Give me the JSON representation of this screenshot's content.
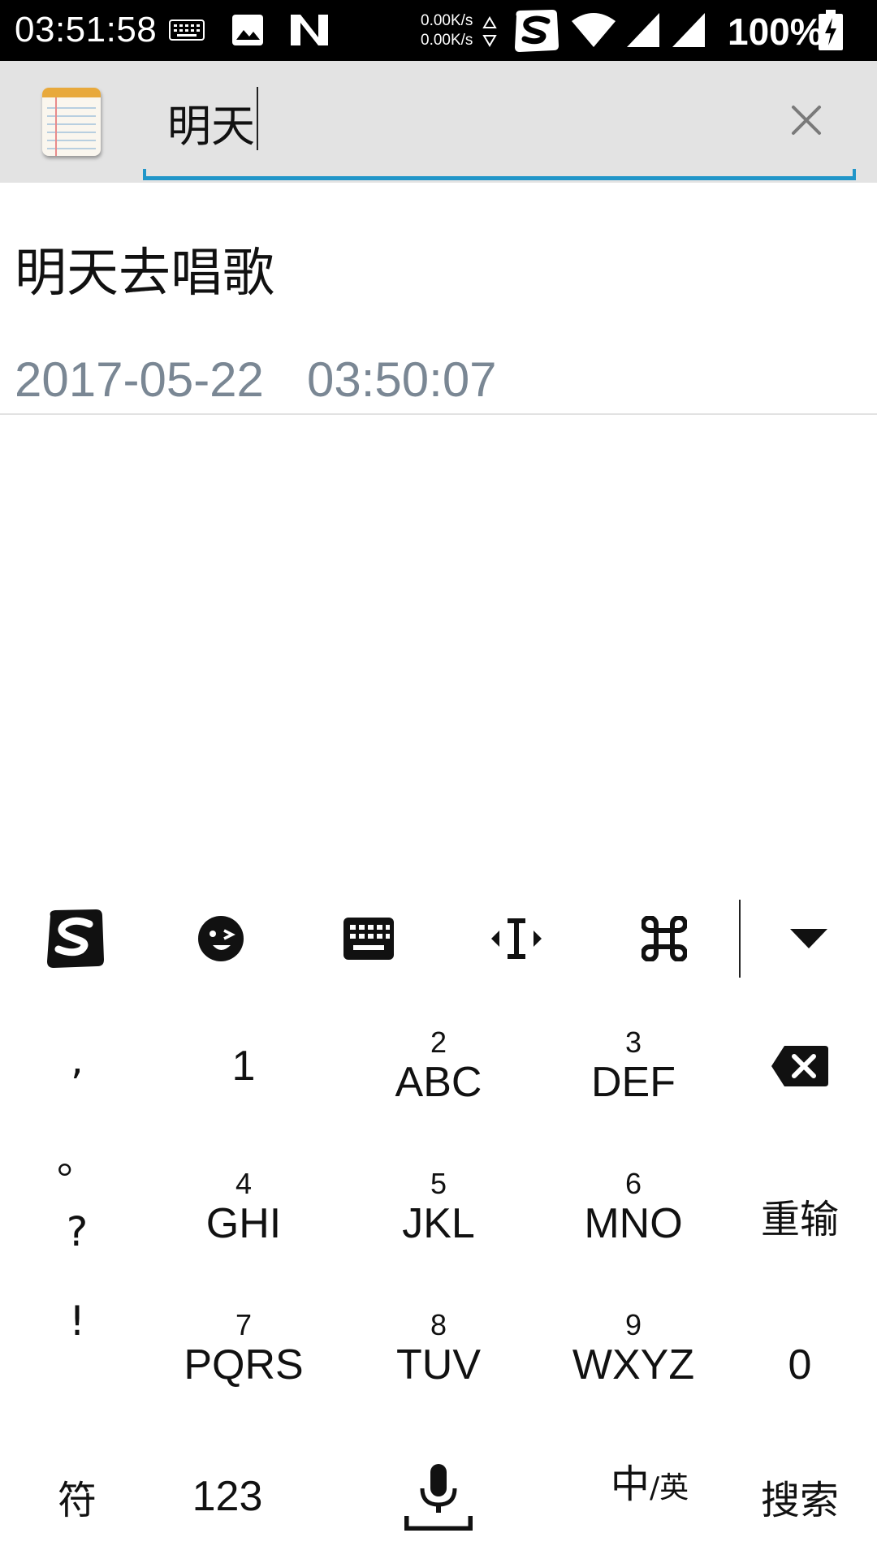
{
  "status_bar": {
    "time": "03:51:58",
    "net_speed_up": "0.00K/s",
    "net_speed_down": "0.00K/s",
    "battery": "100%"
  },
  "search": {
    "query": "明天",
    "clear_icon": "close-icon",
    "underline_color": "#2196c9"
  },
  "result": {
    "title": "明天去唱歌",
    "date": "2017-05-22",
    "time": "03:50:07"
  },
  "keyboard": {
    "toolbar": [
      "sogou-logo-icon",
      "emoji-icon",
      "keyboard-icon",
      "cursor-move-icon",
      "command-icon",
      "collapse-down-icon"
    ],
    "punctuation": [
      ",",
      "。",
      "?",
      "!"
    ],
    "keys": {
      "k1": {
        "num": "",
        "letters": "1"
      },
      "k2": {
        "num": "2",
        "letters": "ABC"
      },
      "k3": {
        "num": "3",
        "letters": "DEF"
      },
      "k4": {
        "num": "4",
        "letters": "GHI"
      },
      "k5": {
        "num": "5",
        "letters": "JKL"
      },
      "k6": {
        "num": "6",
        "letters": "MNO"
      },
      "k7": {
        "num": "7",
        "letters": "PQRS"
      },
      "k8": {
        "num": "8",
        "letters": "TUV"
      },
      "k9": {
        "num": "9",
        "letters": "WXYZ"
      }
    },
    "reset_label": "重输",
    "zero_label": "0",
    "symbol_label": "符",
    "numeric_label": "123",
    "lang_label_main": "中",
    "lang_label_sub": "/英",
    "search_label": "搜索"
  }
}
